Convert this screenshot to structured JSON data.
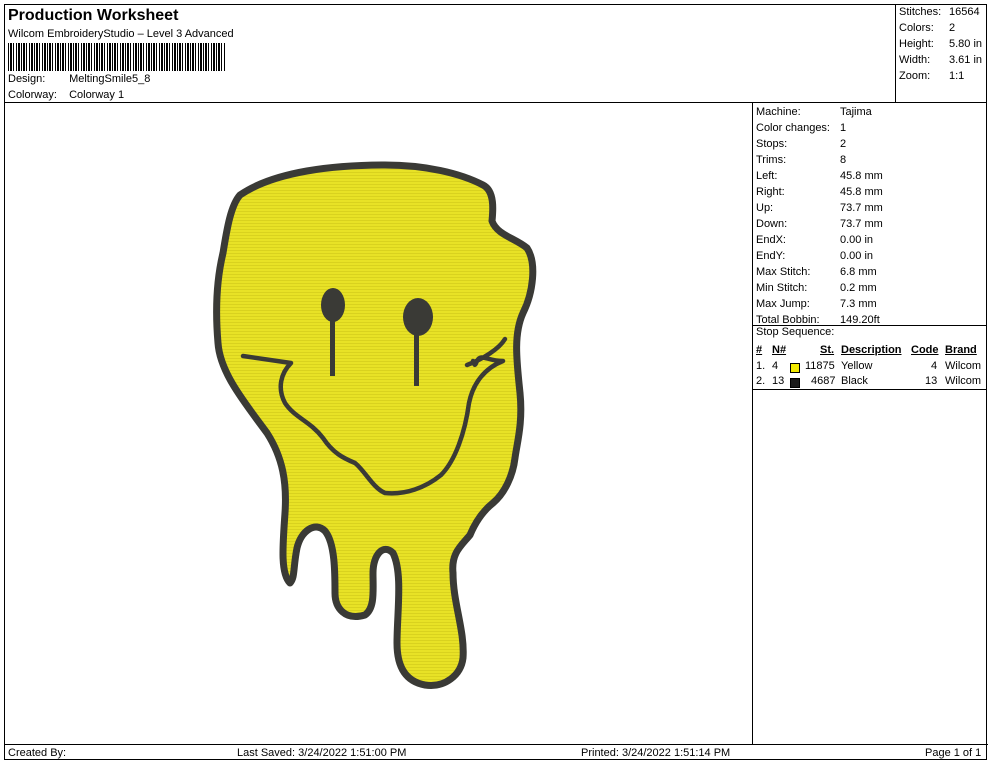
{
  "header": {
    "title": "Production Worksheet",
    "subtitle": "Wilcom EmbroideryStudio – Level 3 Advanced",
    "design_label": "Design:",
    "design_value": "MeltingSmile5_8",
    "colorway_label": "Colorway:",
    "colorway_value": "Colorway 1"
  },
  "stats": [
    {
      "key": "Stitches:",
      "value": "16564"
    },
    {
      "key": "Colors:",
      "value": "2"
    },
    {
      "key": "Height:",
      "value": "5.80 in"
    },
    {
      "key": "Width:",
      "value": "3.61 in"
    },
    {
      "key": "Zoom:",
      "value": "1:1"
    }
  ],
  "machine_info": [
    {
      "key": "Machine:",
      "value": "Tajima"
    },
    {
      "key": "Color changes:",
      "value": "1"
    },
    {
      "key": "Stops:",
      "value": "2"
    },
    {
      "key": "Trims:",
      "value": "8"
    },
    {
      "key": "Left:",
      "value": "45.8 mm"
    },
    {
      "key": "Right:",
      "value": "45.8 mm"
    },
    {
      "key": "Up:",
      "value": "73.7 mm"
    },
    {
      "key": "Down:",
      "value": "73.7 mm"
    },
    {
      "key": "EndX:",
      "value": "0.00 in"
    },
    {
      "key": "EndY:",
      "value": "0.00 in"
    },
    {
      "key": "Max Stitch:",
      "value": "6.8 mm"
    },
    {
      "key": "Min Stitch:",
      "value": "0.2 mm"
    },
    {
      "key": "Max Jump:",
      "value": "7.3 mm"
    },
    {
      "key": "Total Bobbin:",
      "value": "149.20ft"
    }
  ],
  "stop_sequence": {
    "heading": "Stop Sequence:",
    "columns": [
      "#",
      "N#",
      "St.",
      "Description",
      "Code",
      "Brand"
    ],
    "rows": [
      {
        "idx": "1.",
        "n": "4",
        "color": "#f2ea00",
        "st": "11875",
        "desc": "Yellow",
        "code": "4",
        "brand": "Wilcom"
      },
      {
        "idx": "2.",
        "n": "13",
        "color": "#1a1a1a",
        "st": "4687",
        "desc": "Black",
        "code": "13",
        "brand": "Wilcom"
      }
    ]
  },
  "footer": {
    "created": "Created By:",
    "saved": "Last Saved: 3/24/2022 1:51:00 PM",
    "printed": "Printed: 3/24/2022 1:51:14 PM",
    "page": "Page 1 of 1"
  },
  "colors": {
    "fill": "#e6e024",
    "outline": "#3a3a36"
  }
}
